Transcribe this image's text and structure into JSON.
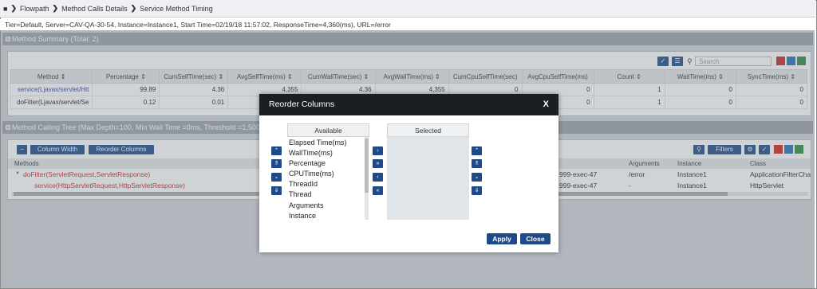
{
  "breadcrumb": {
    "items": [
      "Flowpath",
      "Method Calls Details",
      "Service Method Timing"
    ]
  },
  "infobar": {
    "text": "Tier=Default, Server=CAV-QA-30-54, Instance=Instance1, Start Time=02/19/18 11:57:02, ResponseTime=4,360(ms), URL=/error"
  },
  "summary": {
    "title": "Method Summary (Total: 2)",
    "search_placeholder": "Search",
    "columns": [
      "Method",
      "Percentage",
      "CumSelfTime(sec)",
      "AvgSelfTime(ms)",
      "CumWallTime(sec)",
      "AvgWallTime(ms)",
      "CumCpuSelfTime(sec)",
      "AvgCpuSelfTime(ms)",
      "Count",
      "WaitTime(ms)",
      "SyncTime(ms)"
    ],
    "rows": [
      [
        "service(Ljavax/servlet/Htt",
        "99.89",
        "4.36",
        "4,355",
        "4.36",
        "4,355",
        "0",
        "0",
        "1",
        "0",
        "0"
      ],
      [
        "doFilter(Ljavax/servlet/Se",
        "0.12",
        "0.01",
        "",
        "",
        "",
        "",
        "0",
        "1",
        "0",
        "0"
      ]
    ]
  },
  "tree": {
    "title": "Method Calling Tree (Max Depth=100, Min Wall Time =0ms, Threshold =1,500ms)",
    "column_width_label": "Column Width",
    "reorder_label": "Reorder Columns",
    "filters_label": "Filters",
    "columns_left": "Methods",
    "columns_right": [
      "Arguments",
      "Instance",
      "Class"
    ],
    "rows": [
      {
        "method": "doFilter(ServletRequest,ServletResponse)",
        "thread": "999-exec-47",
        "arguments": "/error",
        "instance": "Instance1",
        "class": "ApplicationFilterCha"
      },
      {
        "method": "service(HttpServletRequest,HttpServletResponse)",
        "thread": "999-exec-47",
        "arguments": "-",
        "instance": "Instance1",
        "class": "HttpServlet"
      }
    ]
  },
  "modal": {
    "title": "Reorder Columns",
    "close": "X",
    "available_label": "Available",
    "selected_label": "Selected",
    "available_items": [
      "Elapsed Time(ms)",
      "WallTime(ms)",
      "Percentage",
      "CPUTime(ms)",
      "ThreadId",
      "Thread",
      "Arguments",
      "Instance"
    ],
    "apply_label": "Apply",
    "close_label": "Close"
  },
  "colors": {
    "button_blue": "#1e4a8a",
    "link_blue": "#2b3fa8",
    "tree_red": "#c22222",
    "modal_header": "#1b1f24"
  }
}
